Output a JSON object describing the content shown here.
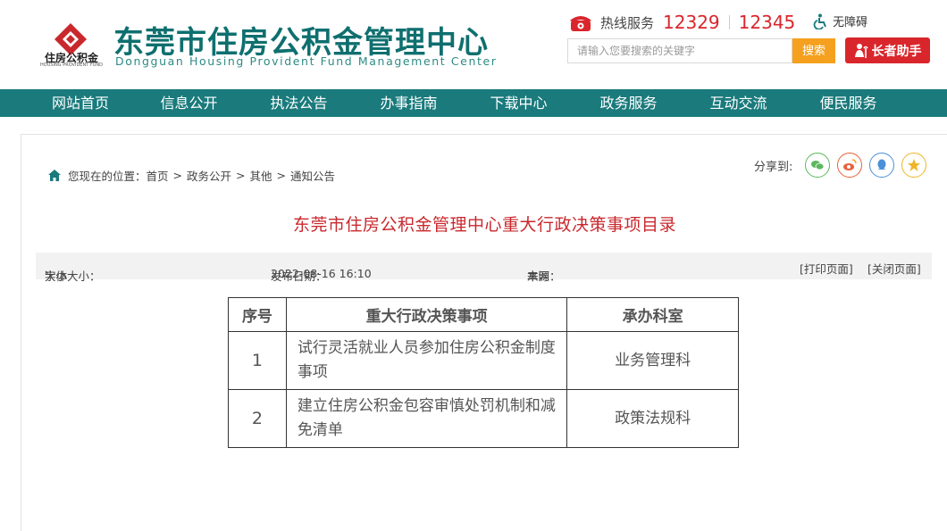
{
  "logo": {
    "title": "东莞市住房公积金管理中心",
    "subtitle": "Dongguan Housing Provident Fund Management Center",
    "small_cn": "住房公积金",
    "small_en": "HOUSING PROVIDENT FUND",
    "emblem_icon": "house-emblem-icon",
    "brand_color": "#c9282d"
  },
  "hotline": {
    "label": "热线服务",
    "numbers": [
      "12329",
      "12345"
    ],
    "icon": "phone-icon"
  },
  "accessibility": {
    "label": "无障碍",
    "icon": "wheelchair-icon"
  },
  "search": {
    "placeholder": "请输入您要搜索的关键字",
    "button_label": "搜索"
  },
  "elder_mode": {
    "label": "长者助手",
    "icon": "elder-icon"
  },
  "nav": {
    "items": [
      "网站首页",
      "信息公开",
      "执法公告",
      "办事指南",
      "下载中心",
      "政务服务",
      "互动交流",
      "便民服务"
    ],
    "bg_color": "#1a7a7c"
  },
  "breadcrumb": {
    "prefix": "您现在的位置：",
    "items": [
      "首页",
      "政务公开",
      "其他",
      "通知公告"
    ],
    "separator": ">"
  },
  "share": {
    "label": "分享到:",
    "icons": [
      "wechat-icon",
      "weibo-icon",
      "qq-icon",
      "favorite-icon"
    ]
  },
  "article": {
    "title": "东莞市住房公积金管理中心重大行政决策事项目录",
    "title_color": "#c9282d",
    "font_size_label": "字体大小：",
    "font_size_options": [
      "大",
      "小"
    ],
    "date_label": "发布日期：",
    "date": "2022-08-16 16:10",
    "source_label": "来源：",
    "source": "本网",
    "print_label": "[打印页面]",
    "close_label": "[关闭页面]"
  },
  "table": {
    "headers": [
      "序号",
      "重大行政决策事项",
      "承办科室"
    ],
    "rows": [
      {
        "no": "1",
        "item": "试行灵活就业人员参加住房公积金制度事项",
        "dept": "业务管理科"
      },
      {
        "no": "2",
        "item": "建立住房公积金包容审慎处罚机制和减免清单",
        "dept": "政策法规科"
      }
    ]
  }
}
